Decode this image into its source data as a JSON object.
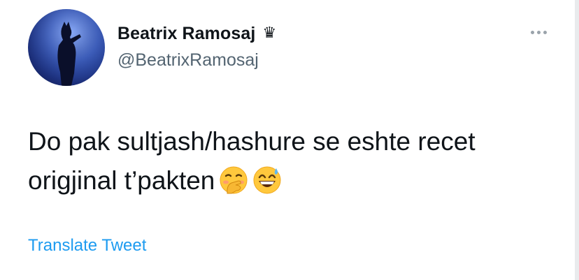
{
  "user": {
    "display_name": "Beatrix Ramosaj",
    "badge_icon": "crown-icon",
    "badge_glyph": "♛",
    "handle": "@BeatrixRamosaj",
    "avatar": "profile-photo"
  },
  "menu": {
    "icon": "more-options-icon"
  },
  "tweet": {
    "text": "Do pak sultjash/hashure se eshte recet origjinal t’pakten",
    "emojis": [
      "face-with-hand-over-mouth-emoji",
      "grinning-face-with-sweat-emoji"
    ]
  },
  "actions": {
    "translate_label": "Translate Tweet"
  },
  "colors": {
    "text_primary": "#0f1419",
    "text_secondary": "#536471",
    "link": "#1d9bf0",
    "background": "#ffffff"
  }
}
